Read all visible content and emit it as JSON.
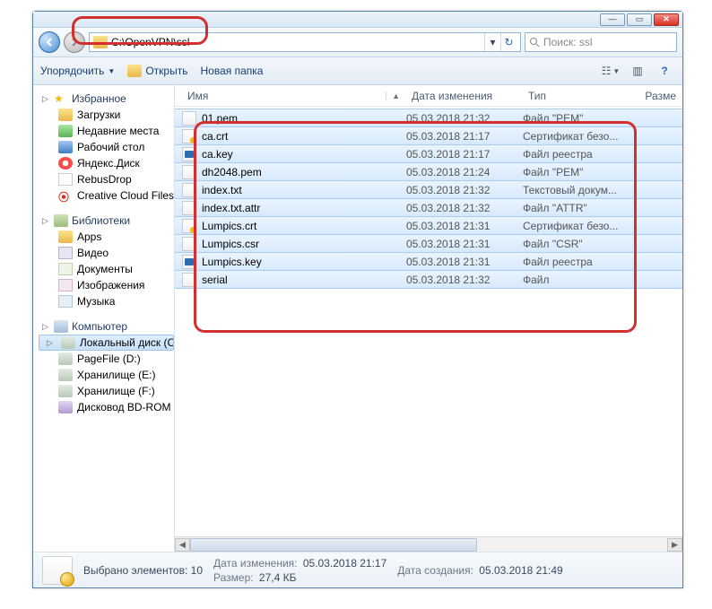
{
  "nav": {
    "address": "C:\\OpenVPN\\ssl",
    "search_placeholder": "Поиск: ssl"
  },
  "toolbar": {
    "organize": "Упорядочить",
    "open": "Открыть",
    "new_folder": "Новая папка"
  },
  "sidebar": {
    "favorites": {
      "label": "Избранное",
      "items": [
        {
          "label": "Загрузки",
          "icon": "folder"
        },
        {
          "label": "Недавние места",
          "icon": "recent"
        },
        {
          "label": "Рабочий стол",
          "icon": "desktop"
        },
        {
          "label": "Яндекс.Диск",
          "icon": "yadisk"
        },
        {
          "label": "RebusDrop",
          "icon": "rebus"
        },
        {
          "label": "Creative Cloud Files",
          "icon": "cc"
        }
      ]
    },
    "libraries": {
      "label": "Библиотеки",
      "items": [
        {
          "label": "Apps",
          "icon": "apps"
        },
        {
          "label": "Видео",
          "icon": "video"
        },
        {
          "label": "Документы",
          "icon": "docs"
        },
        {
          "label": "Изображения",
          "icon": "pics"
        },
        {
          "label": "Музыка",
          "icon": "music"
        }
      ]
    },
    "computer": {
      "label": "Компьютер",
      "items": [
        {
          "label": "Локальный диск (C:)",
          "icon": "drive",
          "selected": true
        },
        {
          "label": "PageFile (D:)",
          "icon": "drive"
        },
        {
          "label": "Хранилище (E:)",
          "icon": "drive"
        },
        {
          "label": "Хранилище (F:)",
          "icon": "drive"
        },
        {
          "label": "Дисковод BD-ROM (I",
          "icon": "bd"
        }
      ]
    }
  },
  "columns": {
    "name": "Имя",
    "date": "Дата изменения",
    "type": "Тип",
    "size": "Разме"
  },
  "files": [
    {
      "name": "01.pem",
      "date": "05.03.2018 21:32",
      "type": "Файл \"PEM\"",
      "icon": "file"
    },
    {
      "name": "ca.crt",
      "date": "05.03.2018 21:17",
      "type": "Сертификат безо...",
      "icon": "crt"
    },
    {
      "name": "ca.key",
      "date": "05.03.2018 21:17",
      "type": "Файл реестра",
      "icon": "key"
    },
    {
      "name": "dh2048.pem",
      "date": "05.03.2018 21:24",
      "type": "Файл \"PEM\"",
      "icon": "file"
    },
    {
      "name": "index.txt",
      "date": "05.03.2018 21:32",
      "type": "Текстовый докум...",
      "icon": "file"
    },
    {
      "name": "index.txt.attr",
      "date": "05.03.2018 21:32",
      "type": "Файл \"ATTR\"",
      "icon": "file"
    },
    {
      "name": "Lumpics.crt",
      "date": "05.03.2018 21:31",
      "type": "Сертификат безо...",
      "icon": "crt"
    },
    {
      "name": "Lumpics.csr",
      "date": "05.03.2018 21:31",
      "type": "Файл \"CSR\"",
      "icon": "file"
    },
    {
      "name": "Lumpics.key",
      "date": "05.03.2018 21:31",
      "type": "Файл реестра",
      "icon": "key"
    },
    {
      "name": "serial",
      "date": "05.03.2018 21:32",
      "type": "Файл",
      "icon": "file"
    }
  ],
  "status": {
    "selected_label": "Выбрано элементов: 10",
    "date_label": "Дата изменения:",
    "date_value": "05.03.2018 21:17",
    "size_label": "Размер:",
    "size_value": "27,4 КБ",
    "created_label": "Дата создания:",
    "created_value": "05.03.2018 21:49"
  }
}
